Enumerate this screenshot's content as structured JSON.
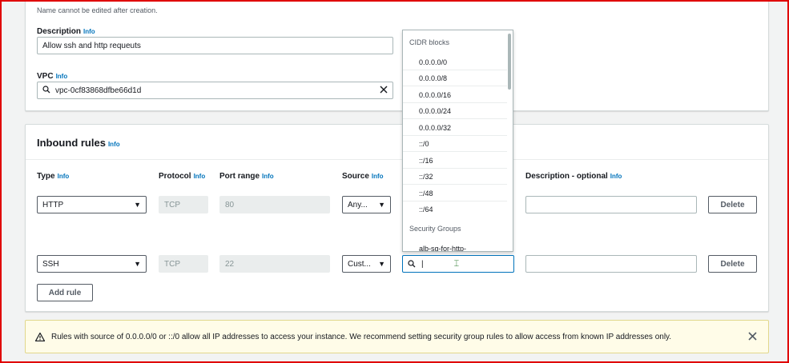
{
  "top": {
    "name_hint": "Name cannot be edited after creation.",
    "description_label": "Description",
    "description_info": "Info",
    "description_value": "Allow ssh and http requeuts",
    "vpc_label": "VPC",
    "vpc_info": "Info",
    "vpc_value": "vpc-0cf83868dfbe66d1d"
  },
  "inbound": {
    "title": "Inbound rules",
    "title_info": "Info",
    "columns": [
      {
        "label": "Type",
        "info": "Info"
      },
      {
        "label": "Protocol",
        "info": "Info"
      },
      {
        "label": "Port range",
        "info": "Info"
      },
      {
        "label": "Source",
        "info": "Info"
      },
      {
        "label": "Description - optional",
        "info": "Info"
      }
    ],
    "rules": [
      {
        "type": "HTTP",
        "protocol": "TCP",
        "port": "80",
        "source": "Any...",
        "description": "",
        "delete_label": "Delete"
      },
      {
        "type": "SSH",
        "protocol": "TCP",
        "port": "22",
        "source": "Cust...",
        "description": "",
        "delete_label": "Delete",
        "search_value": "|"
      }
    ],
    "add_rule_label": "Add rule"
  },
  "dropdown": {
    "group1": "CIDR blocks",
    "cidr_items": [
      "0.0.0.0/0",
      "0.0.0.0/8",
      "0.0.0.0/16",
      "0.0.0.0/24",
      "0.0.0.0/32",
      "::/0",
      "::/16",
      "::/32",
      "::/48",
      "::/64"
    ],
    "group2": "Security Groups",
    "sg_items": [
      "alb-sg-for-http-"
    ]
  },
  "warning": {
    "text": "Rules with source of 0.0.0.0/0 or ::/0 allow all IP addresses to access your instance. We recommend setting security group rules to allow access from known IP addresses only."
  },
  "colors": {
    "info_link": "#0073bb",
    "warning_bg": "#fffce8",
    "frame": "#e00000"
  },
  "icons": [
    "search-icon",
    "clear-icon",
    "caret-down-icon",
    "warning-icon",
    "close-icon"
  ]
}
